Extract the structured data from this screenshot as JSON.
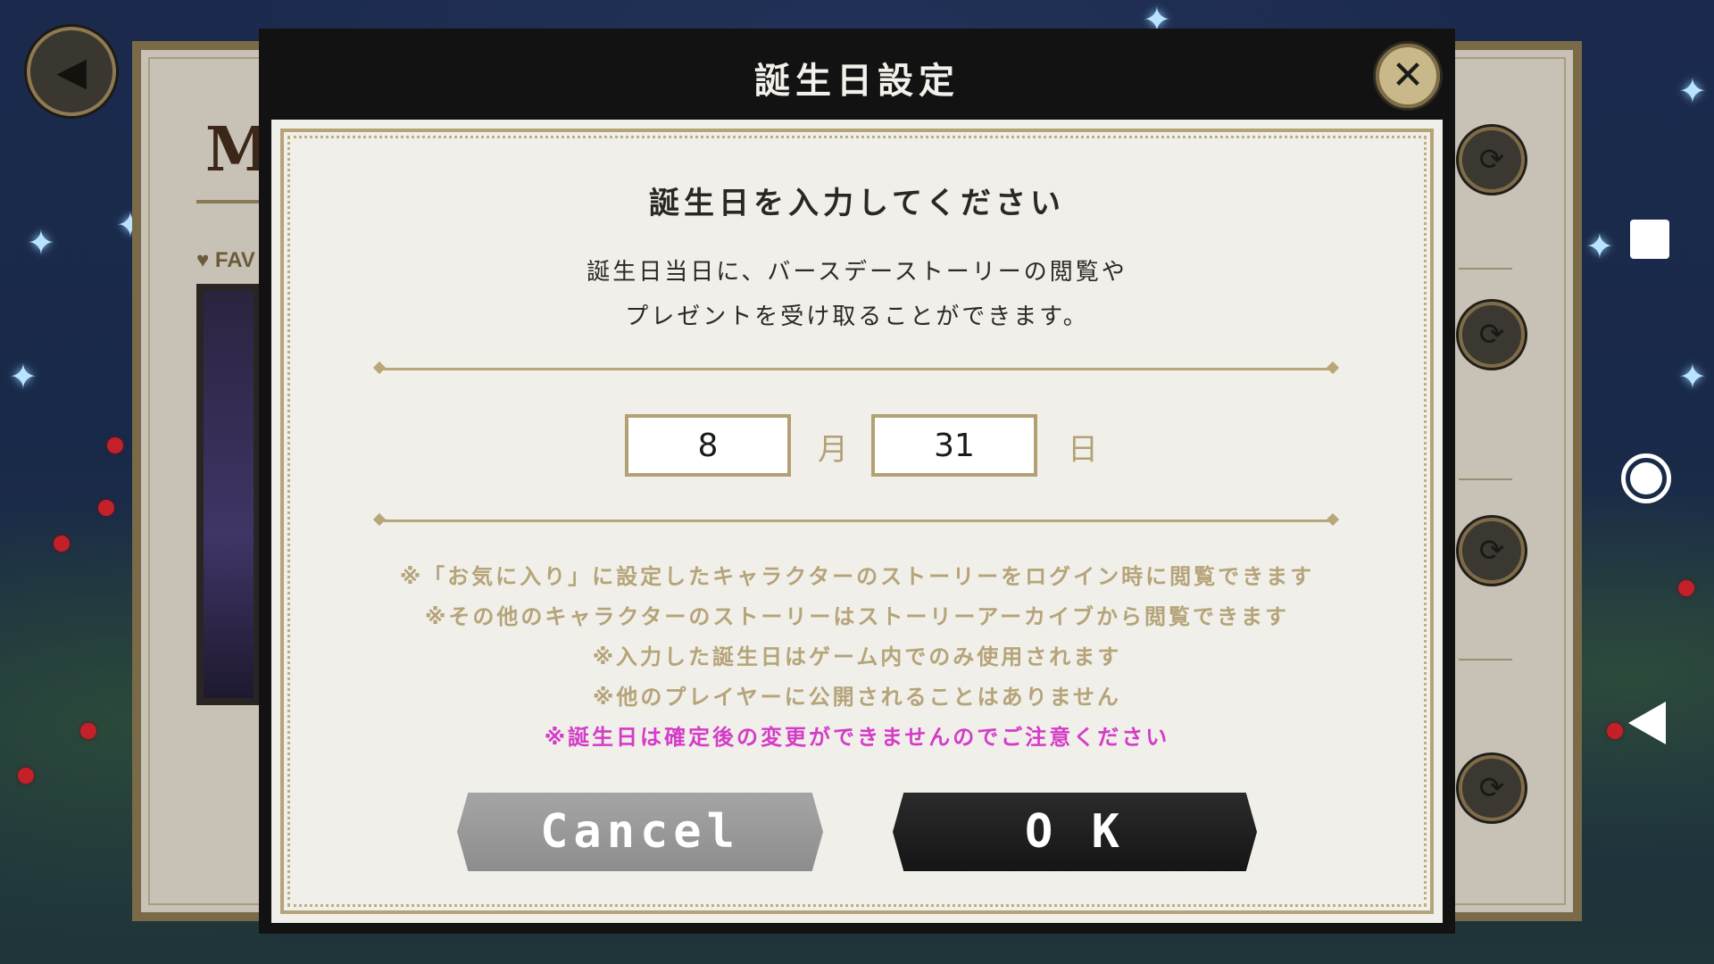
{
  "dialog": {
    "title": "誕生日設定",
    "close_icon": "close-icon",
    "heading": "誕生日を入力してください",
    "description_line1": "誕生日当日に、バースデーストーリーの閲覧や",
    "description_line2": "プレゼントを受け取ることができます。",
    "month_value": "8",
    "month_unit": "月",
    "day_value": "31",
    "day_unit": "日",
    "notes": [
      "※「お気に入り」に設定したキャラクターのストーリーをログイン時に閲覧できます",
      "※その他のキャラクターのストーリーはストーリーアーカイブから閲覧できます",
      "※入力した誕生日はゲーム内でのみ使用されます",
      "※他のプレイヤーに公開されることはありません"
    ],
    "warning": "※誕生日は確定後の変更ができませんのでご注意ください",
    "cancel_label": "Cancel",
    "ok_label": "O K"
  },
  "background": {
    "panel_letter": "M",
    "fav_label": "♥ FAV"
  },
  "colors": {
    "gold_frame": "#b3a175",
    "warning_text": "#d43cc8",
    "note_text": "#b5a479"
  }
}
